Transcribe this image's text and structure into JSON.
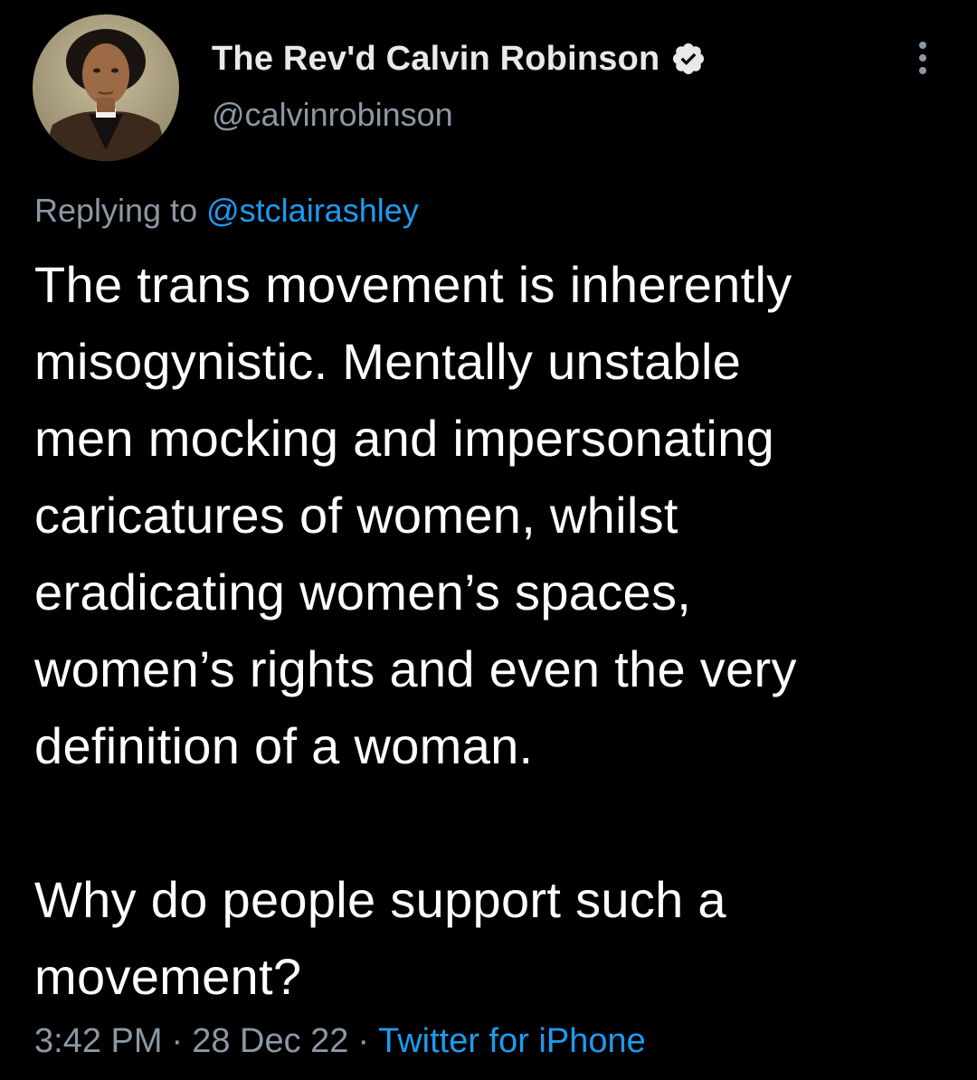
{
  "author": {
    "display_name": "The Rev'd Calvin Robinson",
    "handle": "@calvinrobinson",
    "verified_icon": "verified-badge-icon"
  },
  "reply": {
    "prefix": "Replying to",
    "to_handle": "@stclairashley"
  },
  "tweet": {
    "lines": [
      "The trans movement is inherently",
      "misogynistic. Mentally unstable",
      "men mocking and impersonating",
      "caricatures of women, whilst",
      "eradicating women’s spaces,",
      "women’s rights and even the very",
      "definition of a woman.",
      "",
      "Why do people support such a",
      "movement?"
    ]
  },
  "meta": {
    "time": "3:42 PM",
    "separator": "·",
    "date": "28 Dec 22",
    "source": "Twitter for iPhone"
  },
  "colors": {
    "background": "#000000",
    "text": "#ffffff",
    "secondary": "#8b98a5",
    "accent": "#1d9bf0"
  }
}
